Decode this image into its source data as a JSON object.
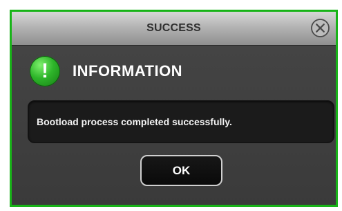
{
  "dialog": {
    "title": "SUCCESS",
    "heading": "INFORMATION",
    "message": "Bootload process completed successfully.",
    "ok_label": "OK",
    "icons": {
      "info": "exclamation-icon",
      "close": "close-icon"
    },
    "colors": {
      "border": "#18b418",
      "icon_green": "#2eb52a",
      "background": "#3c3c3c",
      "message_box": "#1b1b1b"
    }
  }
}
